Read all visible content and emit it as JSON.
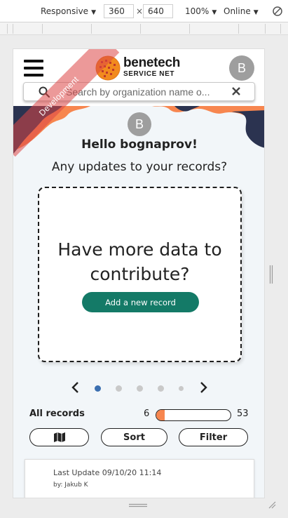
{
  "devtools": {
    "device_mode": "Responsive",
    "width": "360",
    "height": "640",
    "dimension_separator": "×",
    "zoom": "100%",
    "network": "Online",
    "caret": "▼"
  },
  "app": {
    "logo": {
      "name": "benetech",
      "subtitle": "SERVICE NET"
    },
    "user_initial": "B",
    "environment_ribbon": "Development",
    "search": {
      "placeholder": "Search by organization name o..."
    },
    "greeting": "Hello bognaprov!",
    "prompt": "Any updates to your records?",
    "card": {
      "title": "Have more data to contribute?",
      "button_label": "Add a new record"
    },
    "carousel": {
      "dot_count": 5,
      "active_index": 0
    },
    "stats": {
      "label": "All records",
      "current": "6",
      "total": "53",
      "progress_fraction": 0.113
    },
    "toolbar": {
      "map_icon": "map-icon",
      "sort_label": "Sort",
      "filter_label": "Filter"
    },
    "record": {
      "last_update": "Last Update 09/10/20 11:14",
      "by": "by: Jakub K"
    }
  },
  "colors": {
    "brand_green": "#147a67",
    "accent_orange": "#f7864f",
    "navy": "#2b3350",
    "ribbon_red": "#dc4646"
  }
}
